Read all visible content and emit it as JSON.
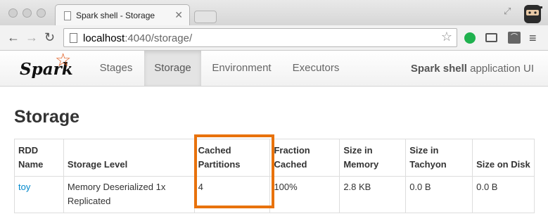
{
  "browser": {
    "tab_title": "Spark shell - Storage",
    "url_host": "localhost",
    "url_path": ":4040/storage/"
  },
  "navbar": {
    "logo_text": "Spark",
    "items": [
      {
        "label": "Stages",
        "active": false
      },
      {
        "label": "Storage",
        "active": true
      },
      {
        "label": "Environment",
        "active": false
      },
      {
        "label": "Executors",
        "active": false
      }
    ],
    "app_name": "Spark shell",
    "app_suffix": " application UI"
  },
  "page": {
    "title": "Storage"
  },
  "table": {
    "headers": [
      "RDD Name",
      "Storage Level",
      "Cached Partitions",
      "Fraction Cached",
      "Size in Memory",
      "Size in Tachyon",
      "Size on Disk"
    ],
    "rows": [
      [
        "toy",
        "Memory Deserialized 1x Replicated",
        "4",
        "100%",
        "2.8 KB",
        "0.0 B",
        "0.0 B"
      ]
    ]
  },
  "colors": {
    "accent_highlight": "#e8720c",
    "link": "#0088cc",
    "spark_orange": "#e25a1c"
  }
}
